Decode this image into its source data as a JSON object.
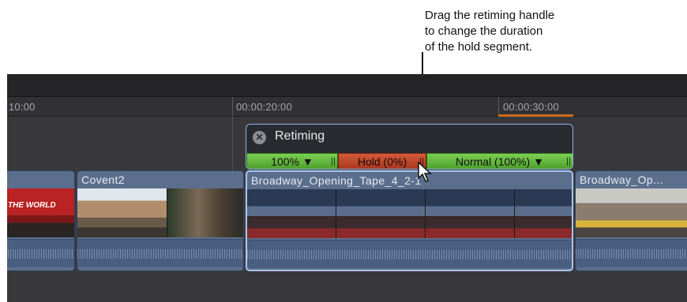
{
  "callout": {
    "line1": "Drag the retiming handle",
    "line2": "to change the duration",
    "line3": "of the hold segment."
  },
  "ruler": {
    "t1": "10:00",
    "t2": "00:00:20:00",
    "t3": "00:00:30:00"
  },
  "retiming": {
    "title": "Retiming",
    "seg1": "100% ▼",
    "seg2": "Hold (0%)",
    "seg3": "Normal (100%) ▼"
  },
  "clips": [
    {
      "name": ""
    },
    {
      "name": "Covent2"
    },
    {
      "name": "Broadway_Opening_Tape_4_2-1"
    },
    {
      "name": "Broadway_Op..."
    }
  ],
  "thumb_labels": {
    "bus_sign": "THE WORLD"
  },
  "colors": {
    "accent_selected": "#a9c6f2",
    "segment_green": "#4ea02c",
    "segment_red": "#a93820",
    "playhead_range": "#c96a1e"
  },
  "icons": {
    "close": "close-icon",
    "pointer": "mouse-pointer-icon",
    "handle": "retime-handle-icon"
  }
}
